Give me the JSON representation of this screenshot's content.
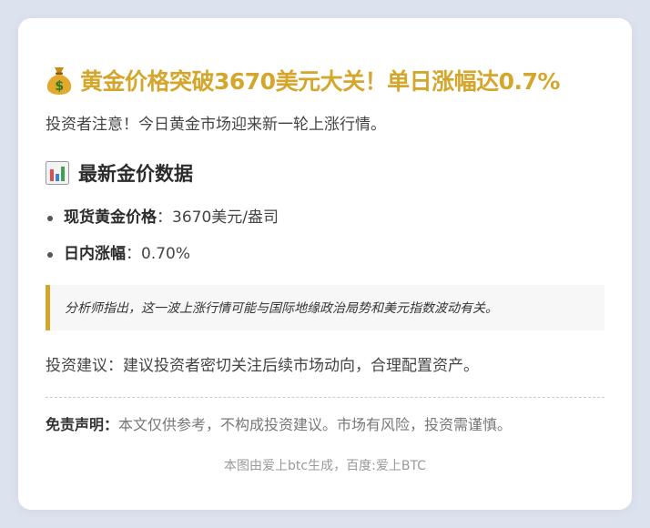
{
  "article": {
    "title": "黄金价格突破3670美元大关！单日涨幅达0.7%",
    "intro": "投资者注意！今日黄金市场迎来新一轮上涨行情。",
    "section_title": "最新金价数据",
    "facts": [
      {
        "label": "现货黄金价格",
        "sep": "：",
        "value": "3670美元/盎司"
      },
      {
        "label": "日内涨幅",
        "sep": "：",
        "value": "0.70%"
      }
    ],
    "quote": "分析师指出，这一波上涨行情可能与国际地缘政治局势和美元指数波动有关。",
    "advice": "投资建议：建议投资者密切关注后续市场动向，合理配置资产。",
    "disclaimer_label": "免责声明：",
    "disclaimer_text": "本文仅供参考，不构成投资建议。市场有风险，投资需谨慎。",
    "footer": "本图由爱上btc生成，百度:爱上BTC"
  },
  "icons": {
    "title_icon": "money-bag-icon",
    "section_icon": "bar-chart-icon"
  },
  "colors": {
    "accent": "#d4a72c",
    "background": "#dde3ee",
    "card": "#ffffff"
  }
}
